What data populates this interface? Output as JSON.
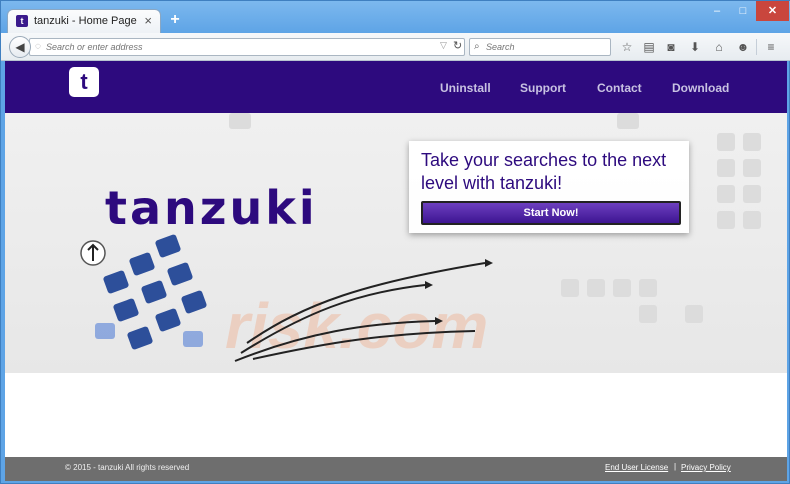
{
  "browser": {
    "tab_title": "tanzuki - Home Page",
    "tab_close": "×",
    "new_tab": "+",
    "url_placeholder": "Search or enter address",
    "search_placeholder": "Search",
    "window_controls": {
      "minimize": "–",
      "maximize": "□",
      "close": "✕"
    }
  },
  "site": {
    "logo_letter": "t",
    "nav": [
      "Uninstall",
      "Support",
      "Contact",
      "Download"
    ],
    "brand": "tanzuki",
    "cta_text": "Take your searches to the next level with tanzuki!",
    "cta_button": "Start Now!",
    "watermark": "risk.com"
  },
  "footer": {
    "copyright": "© 2015 - tanzuki All rights reserved",
    "links": [
      "End User License",
      "Privacy Policy"
    ],
    "separator": "|"
  },
  "colors": {
    "brand": "#2d0a7e",
    "button": "#4b1fa0",
    "footer": "#6e6e6e"
  }
}
